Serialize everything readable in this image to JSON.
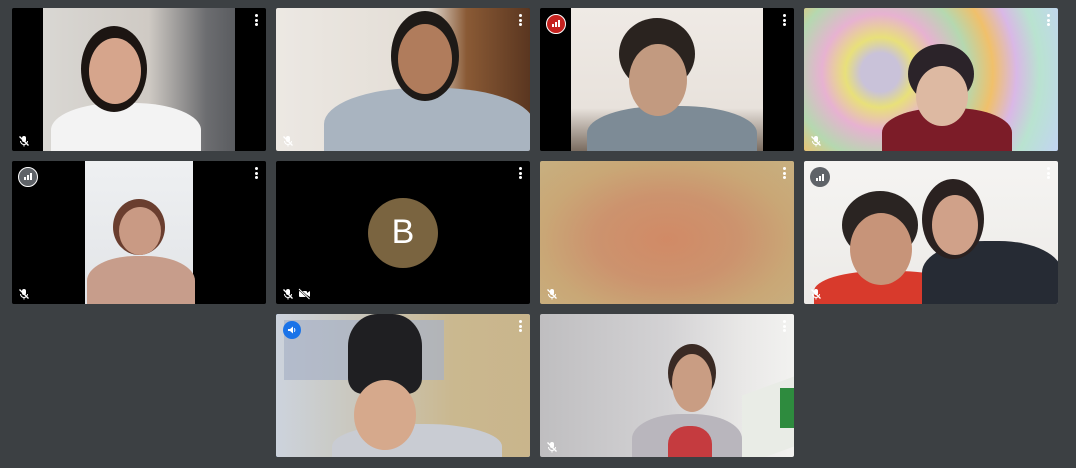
{
  "tiles": [
    {
      "id": "p1",
      "mic": "muted"
    },
    {
      "id": "p2",
      "mic": "muted"
    },
    {
      "id": "p3",
      "mic": "none",
      "signal": "red"
    },
    {
      "id": "p4",
      "mic": "muted"
    },
    {
      "id": "p5",
      "mic": "muted",
      "signal": "gray"
    },
    {
      "id": "p6",
      "mic": "muted",
      "camera": "off",
      "avatar_letter": "B",
      "avatar_color": "#7a6440"
    },
    {
      "id": "p7",
      "mic": "muted"
    },
    {
      "id": "p8",
      "mic": "muted",
      "signal": "plain"
    },
    {
      "id": "p9",
      "mic": "none",
      "speaking": true,
      "active": true
    },
    {
      "id": "p10",
      "mic": "muted"
    }
  ],
  "icons": {
    "more": "more-vert-icon",
    "mic_off": "mic-off-icon",
    "cam_off": "videocam-off-icon",
    "signal": "signal-bars-icon",
    "speaker": "speaker-badge-icon"
  },
  "colors": {
    "background": "#3c4043",
    "active_border": "#4a86e8",
    "poor_signal": "#c5221f",
    "speaking": "#1a73e8"
  }
}
